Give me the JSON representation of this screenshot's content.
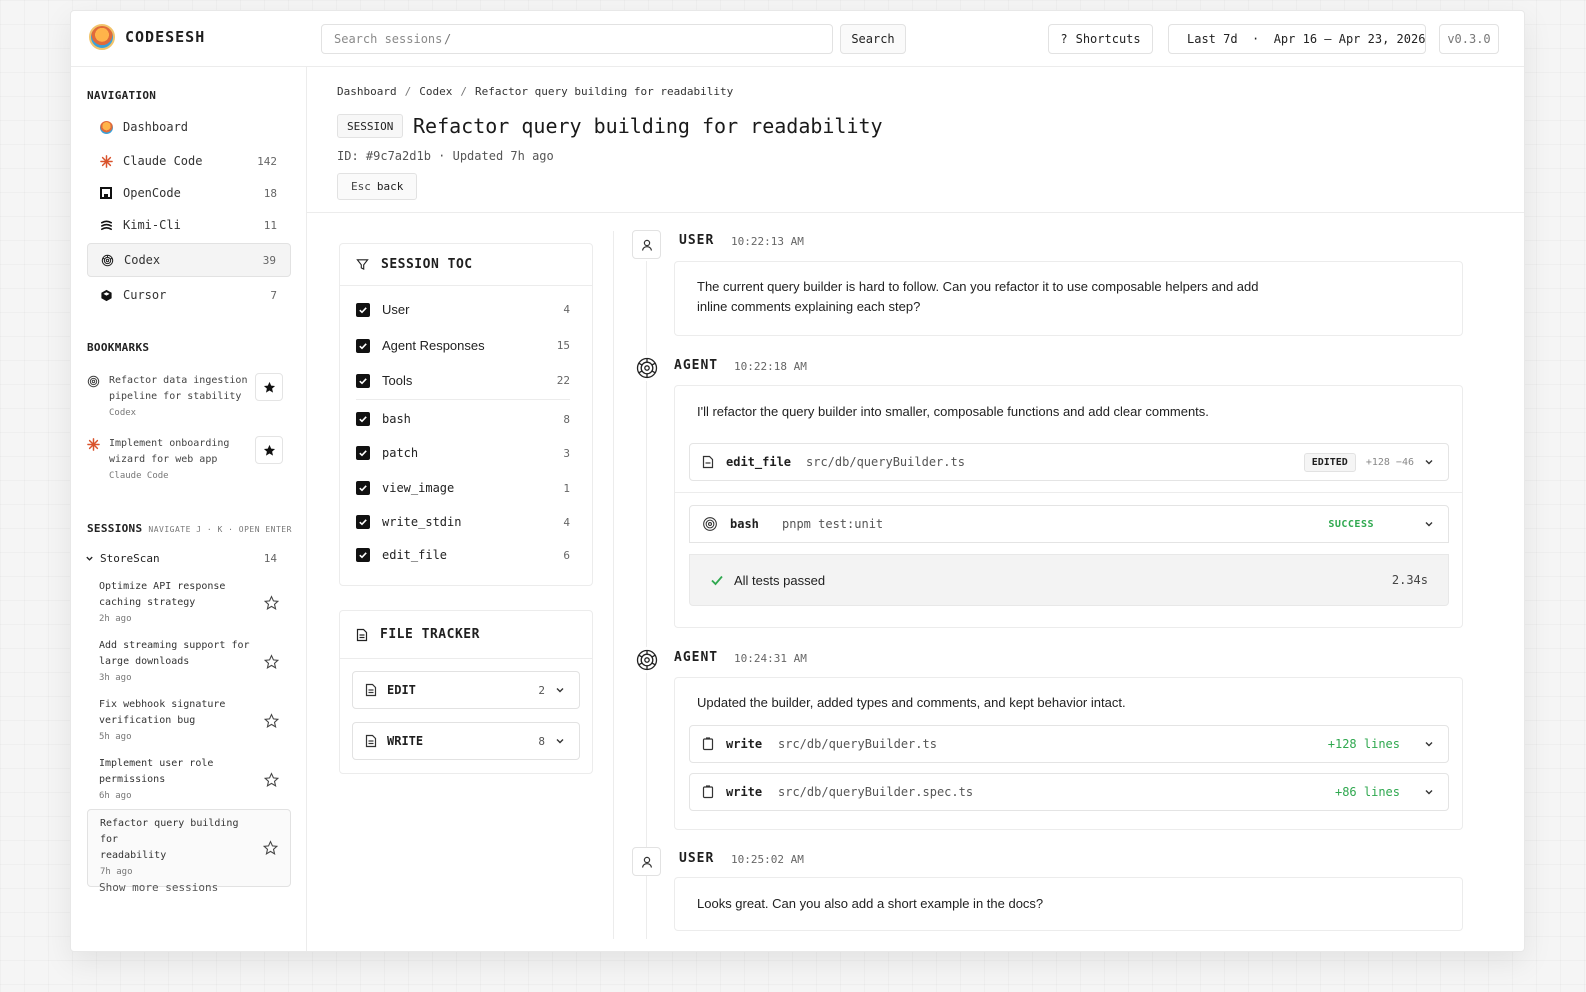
{
  "header": {
    "brand": "CODESESH",
    "search_placeholder": "Search sessions",
    "search_shortcut": "/",
    "search_button": "Search",
    "shortcuts_icon": "?",
    "shortcuts_label": "Shortcuts",
    "date_range": "Last 7d  ·  Apr 16 – Apr 23, 2026",
    "version": "v0.3.0"
  },
  "sidebar": {
    "navigation_title": "NAVIGATION",
    "nav": [
      {
        "label": "Dashboard",
        "count": ""
      },
      {
        "label": "Claude Code",
        "count": "142"
      },
      {
        "label": "OpenCode",
        "count": "18"
      },
      {
        "label": "Kimi-Cli",
        "count": "11"
      },
      {
        "label": "Codex",
        "count": "39"
      },
      {
        "label": "Cursor",
        "count": "7"
      }
    ],
    "bookmarks_title": "BOOKMARKS",
    "bookmarks": [
      {
        "line1": "Refactor data ingestion",
        "line2": "pipeline for stability",
        "source": "Codex"
      },
      {
        "line1": "Implement onboarding",
        "line2": "wizard for web app",
        "source": "Claude Code"
      }
    ],
    "sessions_title": "SESSIONS",
    "sessions_hint": "NAVIGATE J · K · OPEN ENTER",
    "group": {
      "name": "StoreScan",
      "count": "14"
    },
    "sessions": [
      {
        "line1": "Optimize API response",
        "line2": "caching strategy",
        "ago": "2h ago"
      },
      {
        "line1": "Add streaming support for",
        "line2": "large downloads",
        "ago": "3h ago"
      },
      {
        "line1": "Fix webhook signature",
        "line2": "verification bug",
        "ago": "5h ago"
      },
      {
        "line1": "Implement user role",
        "line2": "permissions",
        "ago": "6h ago"
      },
      {
        "line1": "Refactor query building for",
        "line2": "readability",
        "ago": "7h ago"
      }
    ],
    "show_more": "Show more sessions"
  },
  "main": {
    "breadcrumb": [
      "Dashboard",
      "Codex",
      "Refactor query building for readability"
    ],
    "tag": "SESSION",
    "title": "Refactor query building for readability",
    "meta": "ID: #9c7a2d1b · Updated 7h ago",
    "esc_key": "Esc",
    "esc_label": "back"
  },
  "toc": {
    "title": "SESSION TOC",
    "groups": [
      {
        "label": "User",
        "count": "4"
      },
      {
        "label": "Agent Responses",
        "count": "15"
      },
      {
        "label": "Tools",
        "count": "22"
      }
    ],
    "tools": [
      {
        "label": "bash",
        "count": "8"
      },
      {
        "label": "patch",
        "count": "3"
      },
      {
        "label": "view_image",
        "count": "1"
      },
      {
        "label": "write_stdin",
        "count": "4"
      },
      {
        "label": "edit_file",
        "count": "6"
      }
    ]
  },
  "file_tracker": {
    "title": "FILE TRACKER",
    "rows": [
      {
        "label": "EDIT",
        "count": "2"
      },
      {
        "label": "WRITE",
        "count": "8"
      }
    ]
  },
  "conversation": {
    "m1": {
      "role": "USER",
      "time": "10:22:13 AM",
      "text": "The current query builder is hard to follow. Can you refactor it to use composable helpers and add inline comments explaining each step?"
    },
    "m2": {
      "role": "AGENT",
      "time": "10:22:18 AM",
      "text": "I'll refactor the query builder into smaller, composable functions and add clear comments.",
      "tool1": {
        "name": "edit_file",
        "path": "src/db/queryBuilder.ts",
        "badge": "EDITED",
        "diff": "+128 −46"
      },
      "tool2": {
        "name": "bash",
        "path": "pnpm test:unit",
        "status": "SUCCESS"
      },
      "result": {
        "text": "All tests passed",
        "duration": "2.34s"
      }
    },
    "m3": {
      "role": "AGENT",
      "time": "10:24:31 AM",
      "text": "Updated the builder, added types and comments, and kept behavior intact.",
      "tool1": {
        "name": "write",
        "path": "src/db/queryBuilder.ts",
        "lines": "+128 lines"
      },
      "tool2": {
        "name": "write",
        "path": "src/db/queryBuilder.spec.ts",
        "lines": "+86 lines"
      }
    },
    "m4": {
      "role": "USER",
      "time": "10:25:02 AM",
      "text": "Looks great. Can you also add a short example in the docs?"
    }
  },
  "colors": {
    "success": "#2fa84f",
    "accent_dark": "#111111",
    "border": "#ececec"
  }
}
